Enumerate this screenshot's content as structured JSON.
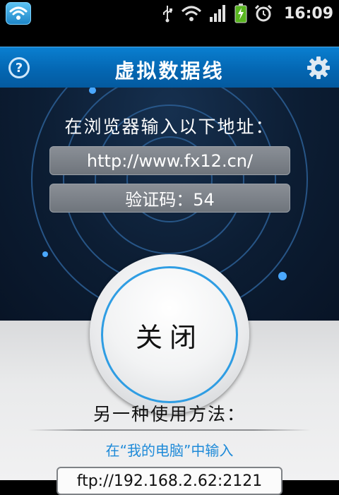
{
  "status_bar": {
    "time": "16:09",
    "icons": [
      "wifi-app-icon",
      "usb-icon",
      "wifi-signal-icon",
      "cell-signal-icon",
      "battery-charging-icon",
      "alarm-icon"
    ]
  },
  "header": {
    "title": "虚拟数据线",
    "help_label": "?"
  },
  "main": {
    "heading": "在浏览器输入以下地址：",
    "url": "http://www.fx12.cn/",
    "verification": "验证码：54",
    "close_label": "关闭"
  },
  "alternative": {
    "heading": "另一种使用方法：",
    "instruction": "在“我的电脑”中输入",
    "ftp_address": "ftp://192.168.2.62:2121"
  },
  "colors": {
    "title_bar": "#0467b3",
    "accent": "#2f9de3",
    "dark_panel": "#0c1d33",
    "link_text": "#1e8ad8"
  }
}
